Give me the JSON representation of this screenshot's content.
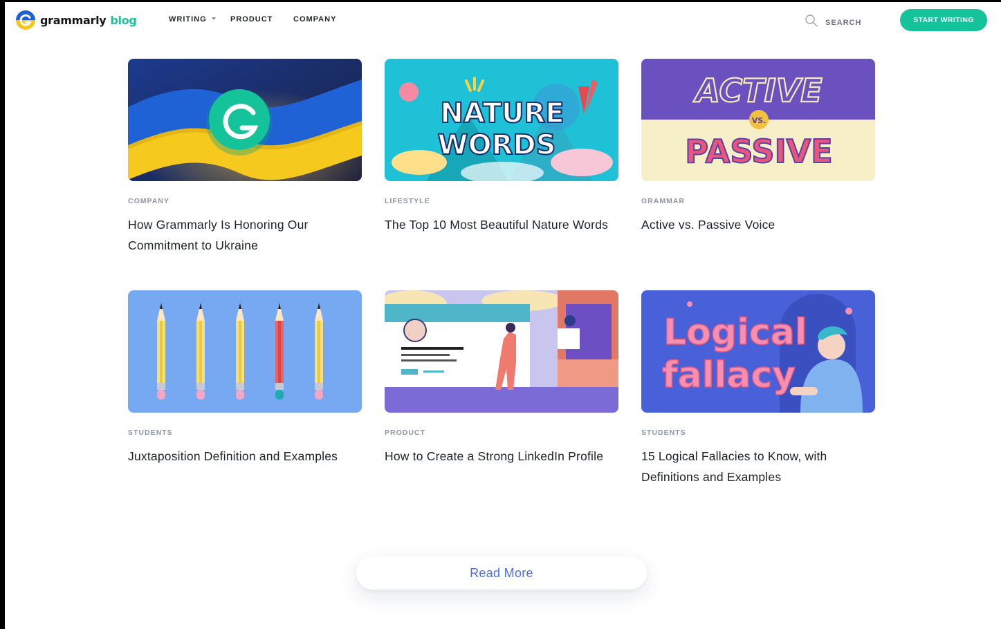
{
  "header": {
    "logo_text": "grammarly",
    "logo_suffix": "blog",
    "nav": [
      {
        "label": "WRITING",
        "has_dropdown": true
      },
      {
        "label": "PRODUCT",
        "has_dropdown": false
      },
      {
        "label": "COMPANY",
        "has_dropdown": false
      }
    ],
    "search_label": "SEARCH",
    "search_icon": "search-icon",
    "cta_label": "START WRITING"
  },
  "articles": [
    {
      "category": "COMPANY",
      "title": "How Grammarly Is Honoring Our Commitment to Ukraine",
      "image": "ukraine-flag-grammarly-logo"
    },
    {
      "category": "LIFESTYLE",
      "title": "The Top 10 Most Beautiful Nature Words",
      "image": "nature-words-illustration",
      "image_text": [
        "NATURE",
        "WORDS"
      ]
    },
    {
      "category": "GRAMMAR",
      "title": "Active vs. Passive Voice",
      "image": "active-vs-passive-illustration",
      "image_text": [
        "ACTIVE",
        "VS.",
        "PASSIVE"
      ]
    },
    {
      "category": "STUDENTS",
      "title": "Juxtaposition Definition and Examples",
      "image": "pencils-illustration"
    },
    {
      "category": "PRODUCT",
      "title": "How to Create a Strong LinkedIn Profile",
      "image": "linkedin-profile-illustration"
    },
    {
      "category": "STUDENTS",
      "title": "15 Logical Fallacies to Know, with Definitions and Examples",
      "image": "logical-fallacy-illustration",
      "image_text": [
        "Logical",
        "fallacy"
      ]
    }
  ],
  "read_more_label": "Read More",
  "colors": {
    "brand_green": "#15c39a",
    "link_blue": "#4a6ee0",
    "category_gray": "#8c95a3"
  }
}
